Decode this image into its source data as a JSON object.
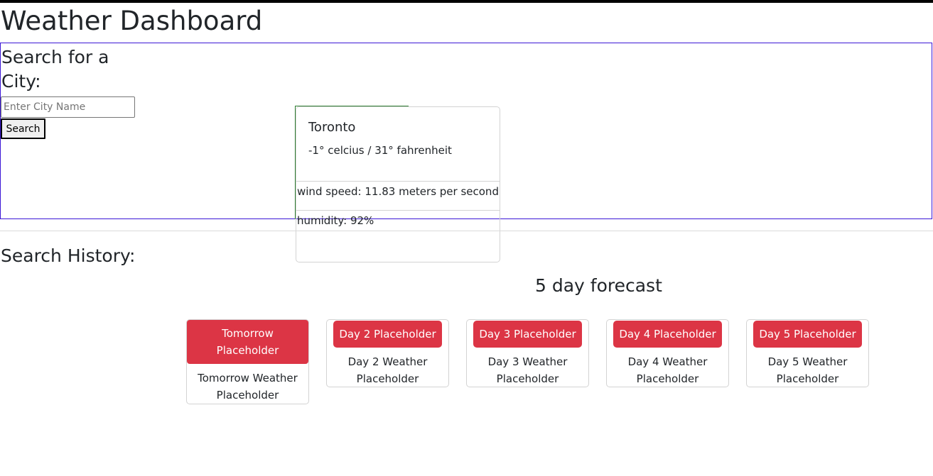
{
  "header": {
    "title": "Weather Dashboard"
  },
  "search": {
    "heading": "Search for a City:",
    "placeholder": "Enter City Name",
    "value": "",
    "button_label": "Search"
  },
  "current": {
    "city": "Toronto",
    "temperature": "-1° celcius / 31° fahrenheit",
    "wind": "wind speed: 11.83 meters per second",
    "humidity": "humidity: 92%"
  },
  "history": {
    "heading": "Search History:"
  },
  "forecast": {
    "heading": "5 day forecast",
    "days": [
      {
        "label": "Tomorrow Placeholder",
        "weather": "Tomorrow Weather Placeholder"
      },
      {
        "label": "Day 2 Placeholder",
        "weather": "Day 2 Weather Placeholder"
      },
      {
        "label": "Day 3 Placeholder",
        "weather": "Day 3 Weather Placeholder"
      },
      {
        "label": "Day 4 Placeholder",
        "weather": "Day 4 Weather Placeholder"
      },
      {
        "label": "Day 5 Placeholder",
        "weather": "Day 5 Weather Placeholder"
      }
    ]
  },
  "colors": {
    "accent_red": "#dc3545",
    "search_border": "#3b17d6",
    "card_border": "#d3d3d3"
  }
}
